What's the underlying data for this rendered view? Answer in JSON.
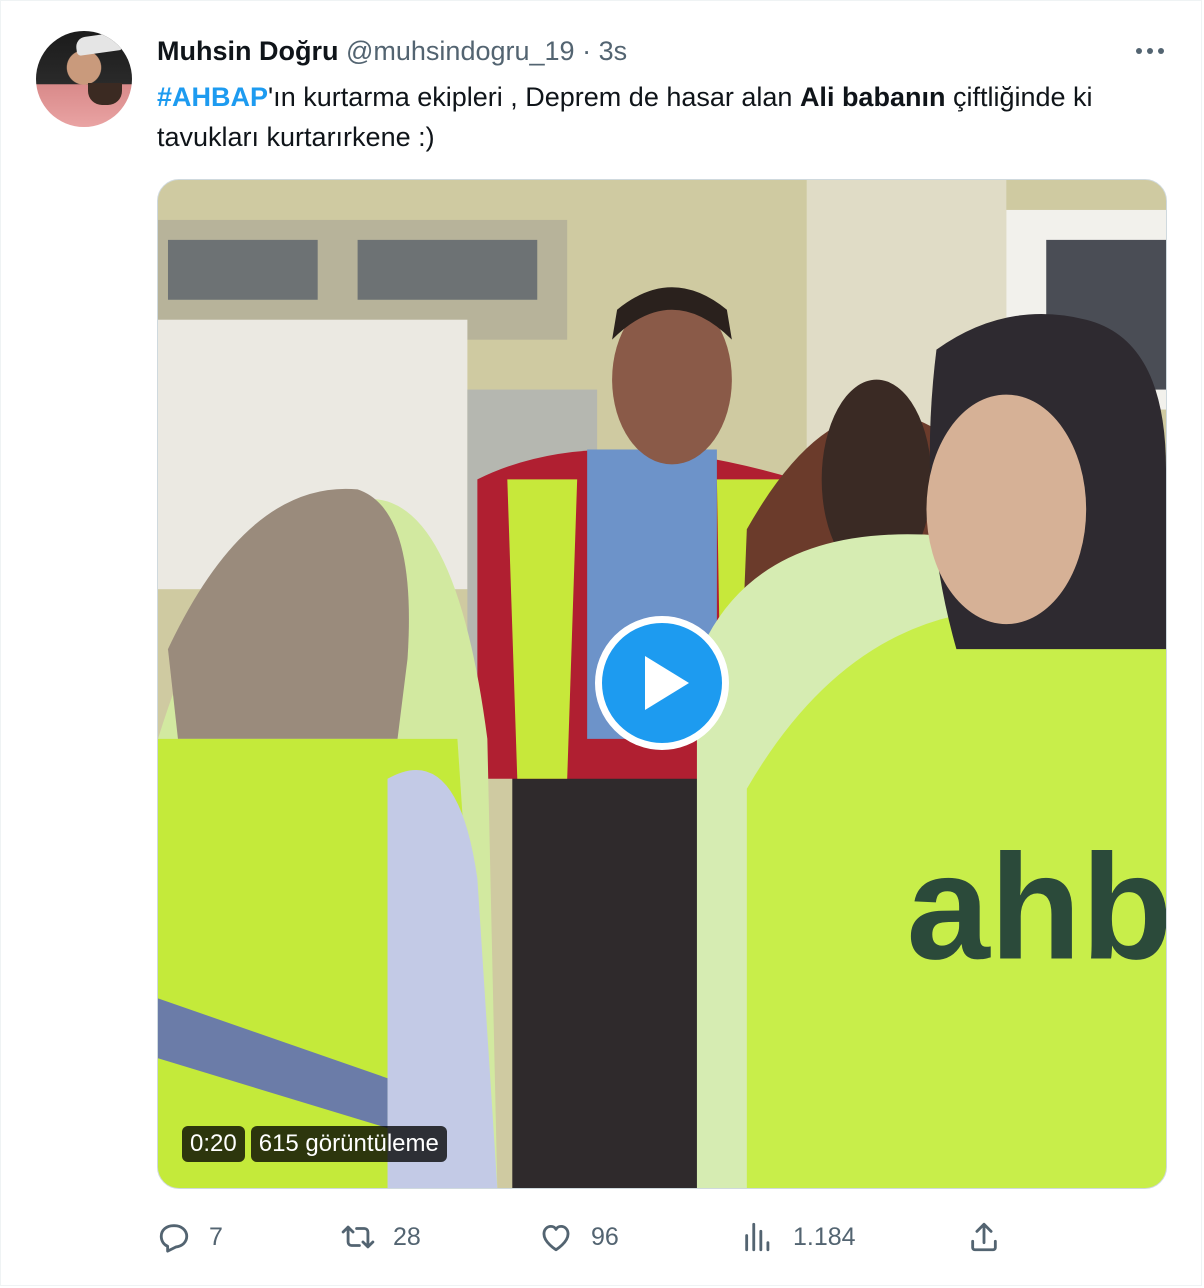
{
  "tweet": {
    "author_name": "Muhsin Doğru",
    "author_handle": "@muhsindogru_19",
    "separator": "·",
    "timestamp": "3s",
    "text_parts": {
      "hashtag": "#AHBAP",
      "part1": "'ın kurtarma ekipleri , Deprem de hasar alan ",
      "bold": "Ali babanın",
      "part2": " çiftliğinde ki tavukları kurtarırkene :)"
    }
  },
  "video": {
    "duration": "0:20",
    "views": "615 görüntüleme",
    "vest_text": "ahb"
  },
  "actions": {
    "replies": "7",
    "retweets": "28",
    "likes": "96",
    "views": "1.184"
  },
  "icons": [
    "avatar",
    "more-icon",
    "play-icon",
    "reply-icon",
    "retweet-icon",
    "like-icon",
    "analytics-icon",
    "share-icon"
  ],
  "colors": {
    "accent": "#1d9bf0",
    "muted": "#536471",
    "text": "#0f1419"
  }
}
